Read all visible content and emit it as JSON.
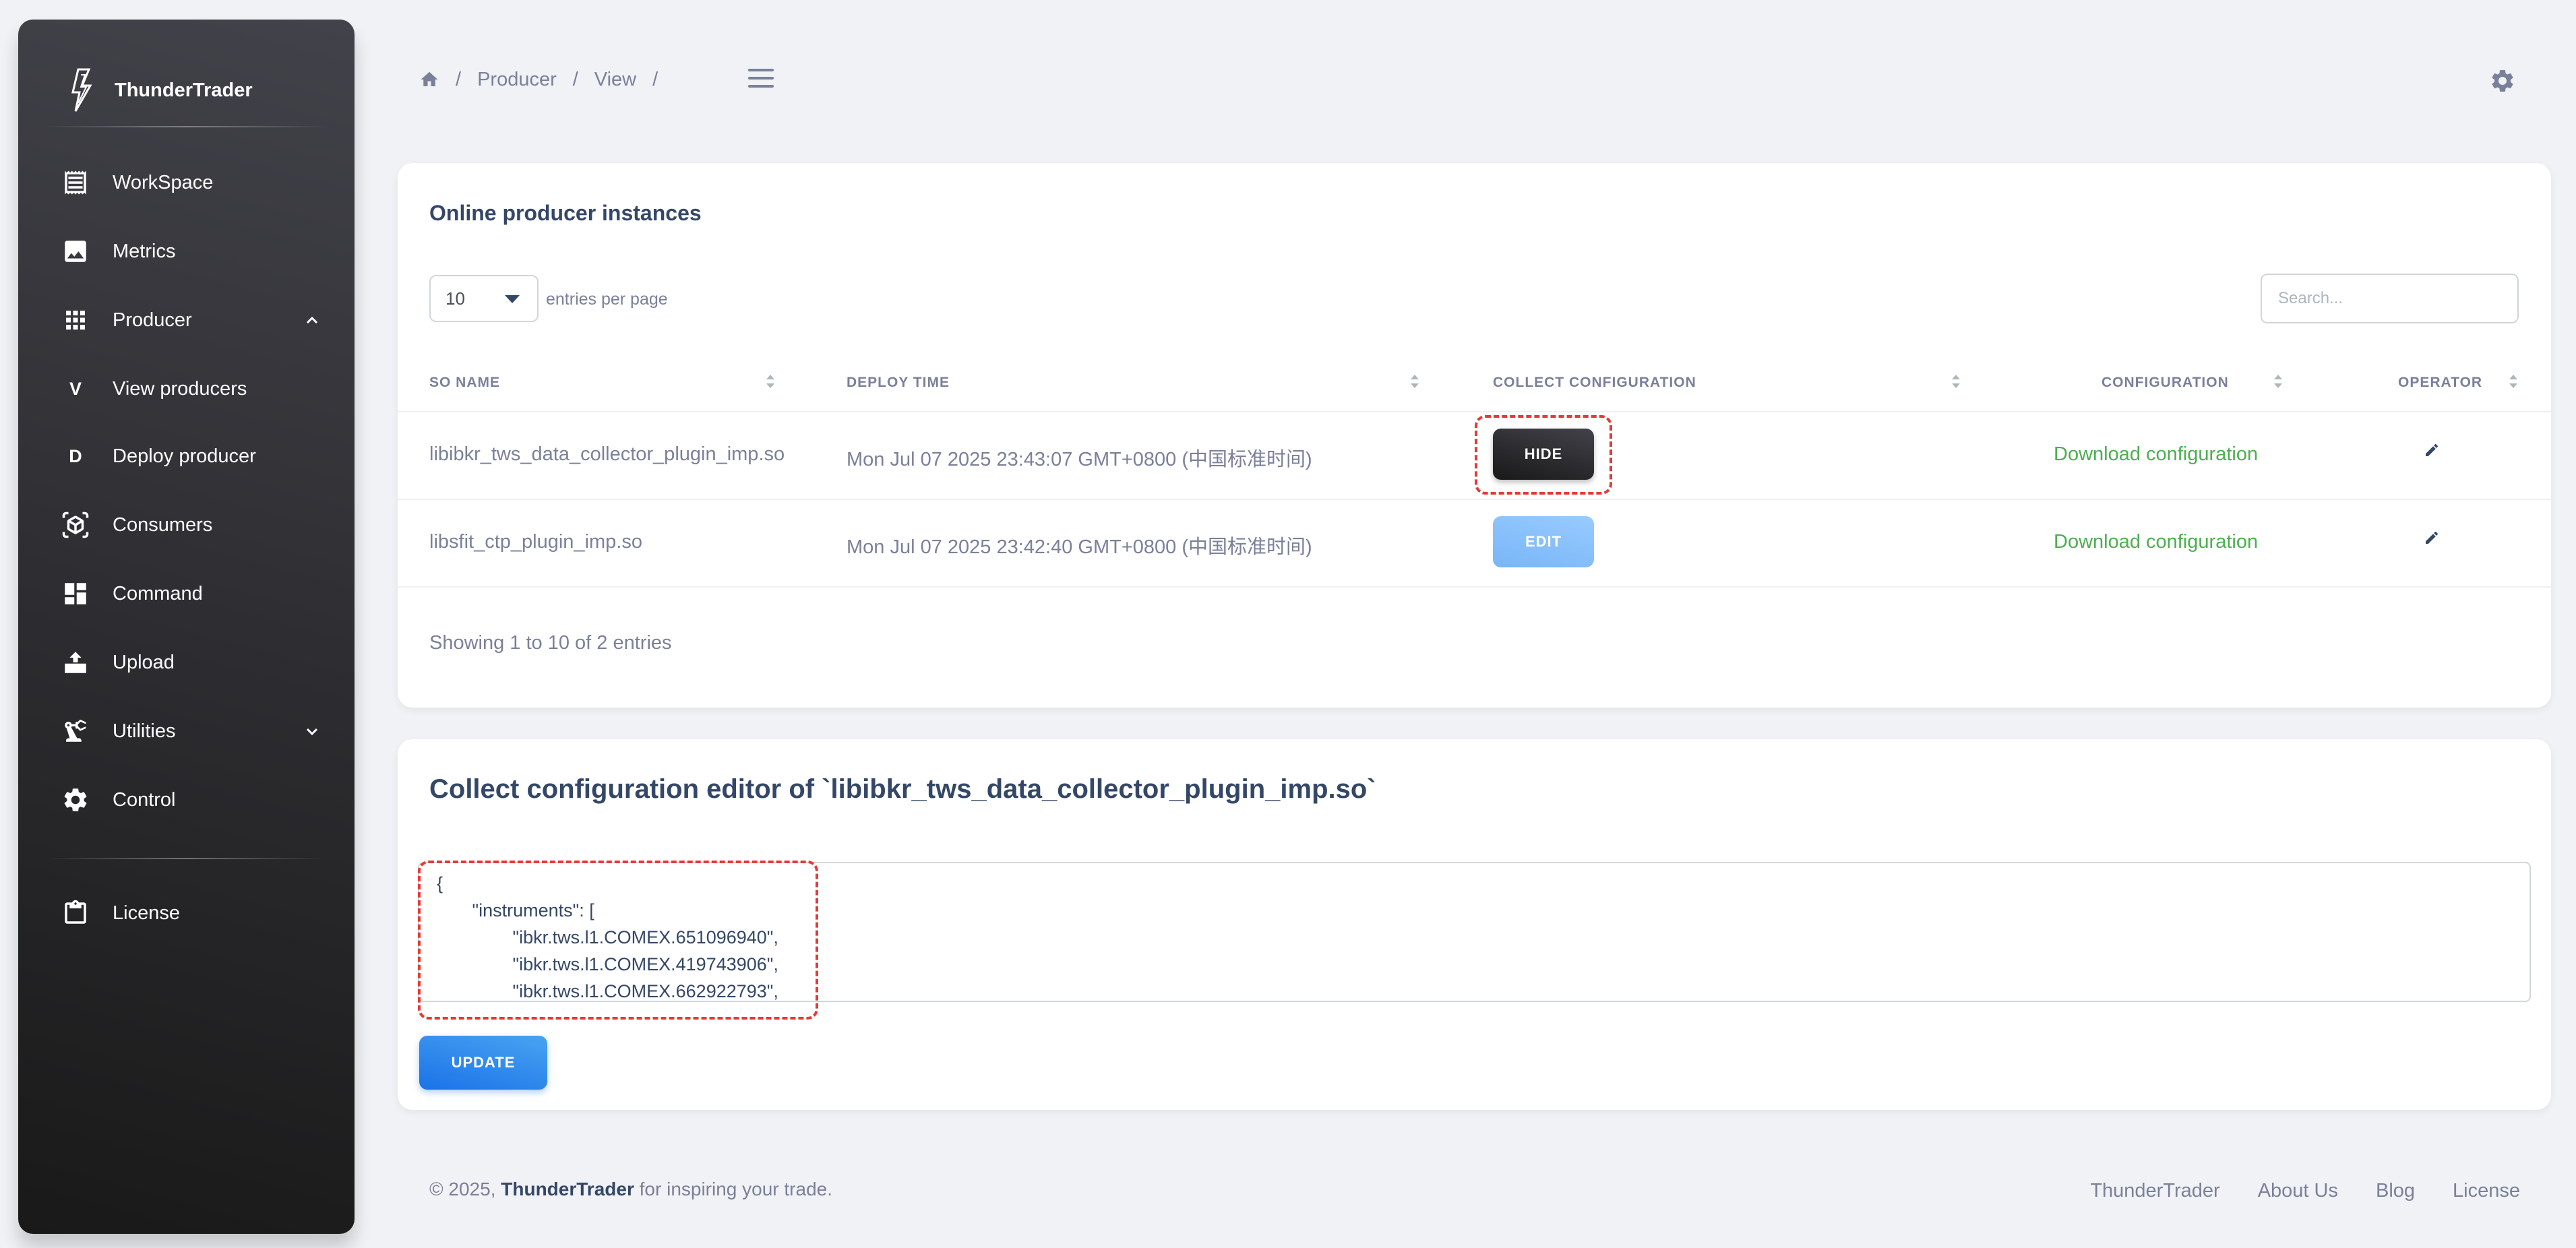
{
  "brand": {
    "name": "ThunderTrader"
  },
  "sidebar": {
    "items": [
      {
        "label": "WorkSpace",
        "icon": "receipt-icon"
      },
      {
        "label": "Metrics",
        "icon": "image-icon"
      },
      {
        "label": "Producer",
        "icon": "apps-grid-icon",
        "expanded": true
      },
      {
        "label": "View producers",
        "letter": "V"
      },
      {
        "label": "Deploy producer",
        "letter": "D"
      },
      {
        "label": "Consumers",
        "icon": "view-in-ar-icon"
      },
      {
        "label": "Command",
        "icon": "dashboard-icon"
      },
      {
        "label": "Upload",
        "icon": "upload-icon"
      },
      {
        "label": "Utilities",
        "icon": "precision-manufacturing-icon",
        "expanded": false
      },
      {
        "label": "Control",
        "icon": "gear-icon"
      },
      {
        "label": "License",
        "icon": "clipboard-icon"
      }
    ]
  },
  "breadcrumb": {
    "items": [
      "Producer",
      "View"
    ]
  },
  "instances_card": {
    "title": "Online producer instances",
    "per_page_value": "10",
    "per_page_label": "entries per page",
    "search_placeholder": "Search...",
    "columns": [
      "SO NAME",
      "DEPLOY TIME",
      "COLLECT CONFIGURATION",
      "CONFIGURATION",
      "OPERATOR"
    ],
    "rows": [
      {
        "so_name": "libibkr_tws_data_collector_plugin_imp.so",
        "deploy_time": "Mon Jul 07 2025 23:43:07 GMT+0800 (中国标准时间)",
        "collect_button": "HIDE",
        "configuration_link": "Download configuration"
      },
      {
        "so_name": "libsfit_ctp_plugin_imp.so",
        "deploy_time": "Mon Jul 07 2025 23:42:40 GMT+0800 (中国标准时间)",
        "collect_button": "EDIT",
        "configuration_link": "Download configuration"
      }
    ],
    "showing": "Showing 1 to 10 of 2 entries"
  },
  "editor_card": {
    "title": "Collect configuration editor of `libibkr_tws_data_collector_plugin_imp.so`",
    "content_lines": [
      "{",
      "       \"instruments\": [",
      "               \"ibkr.tws.l1.COMEX.651096940\",",
      "               \"ibkr.tws.l1.COMEX.419743906\",",
      "               \"ibkr.tws.l1.COMEX.662922793\","
    ],
    "update_button": "UPDATE"
  },
  "footer": {
    "copyright_prefix": "© 2025,",
    "brand": "ThunderTrader",
    "copyright_suffix": "for inspiring your trade.",
    "links": [
      "ThunderTrader",
      "About Us",
      "Blog",
      "License"
    ]
  },
  "colors": {
    "accent": "#1a73e8",
    "success": "#4caf50",
    "highlight": "#e53935",
    "sidebar_dark": "#191919"
  }
}
